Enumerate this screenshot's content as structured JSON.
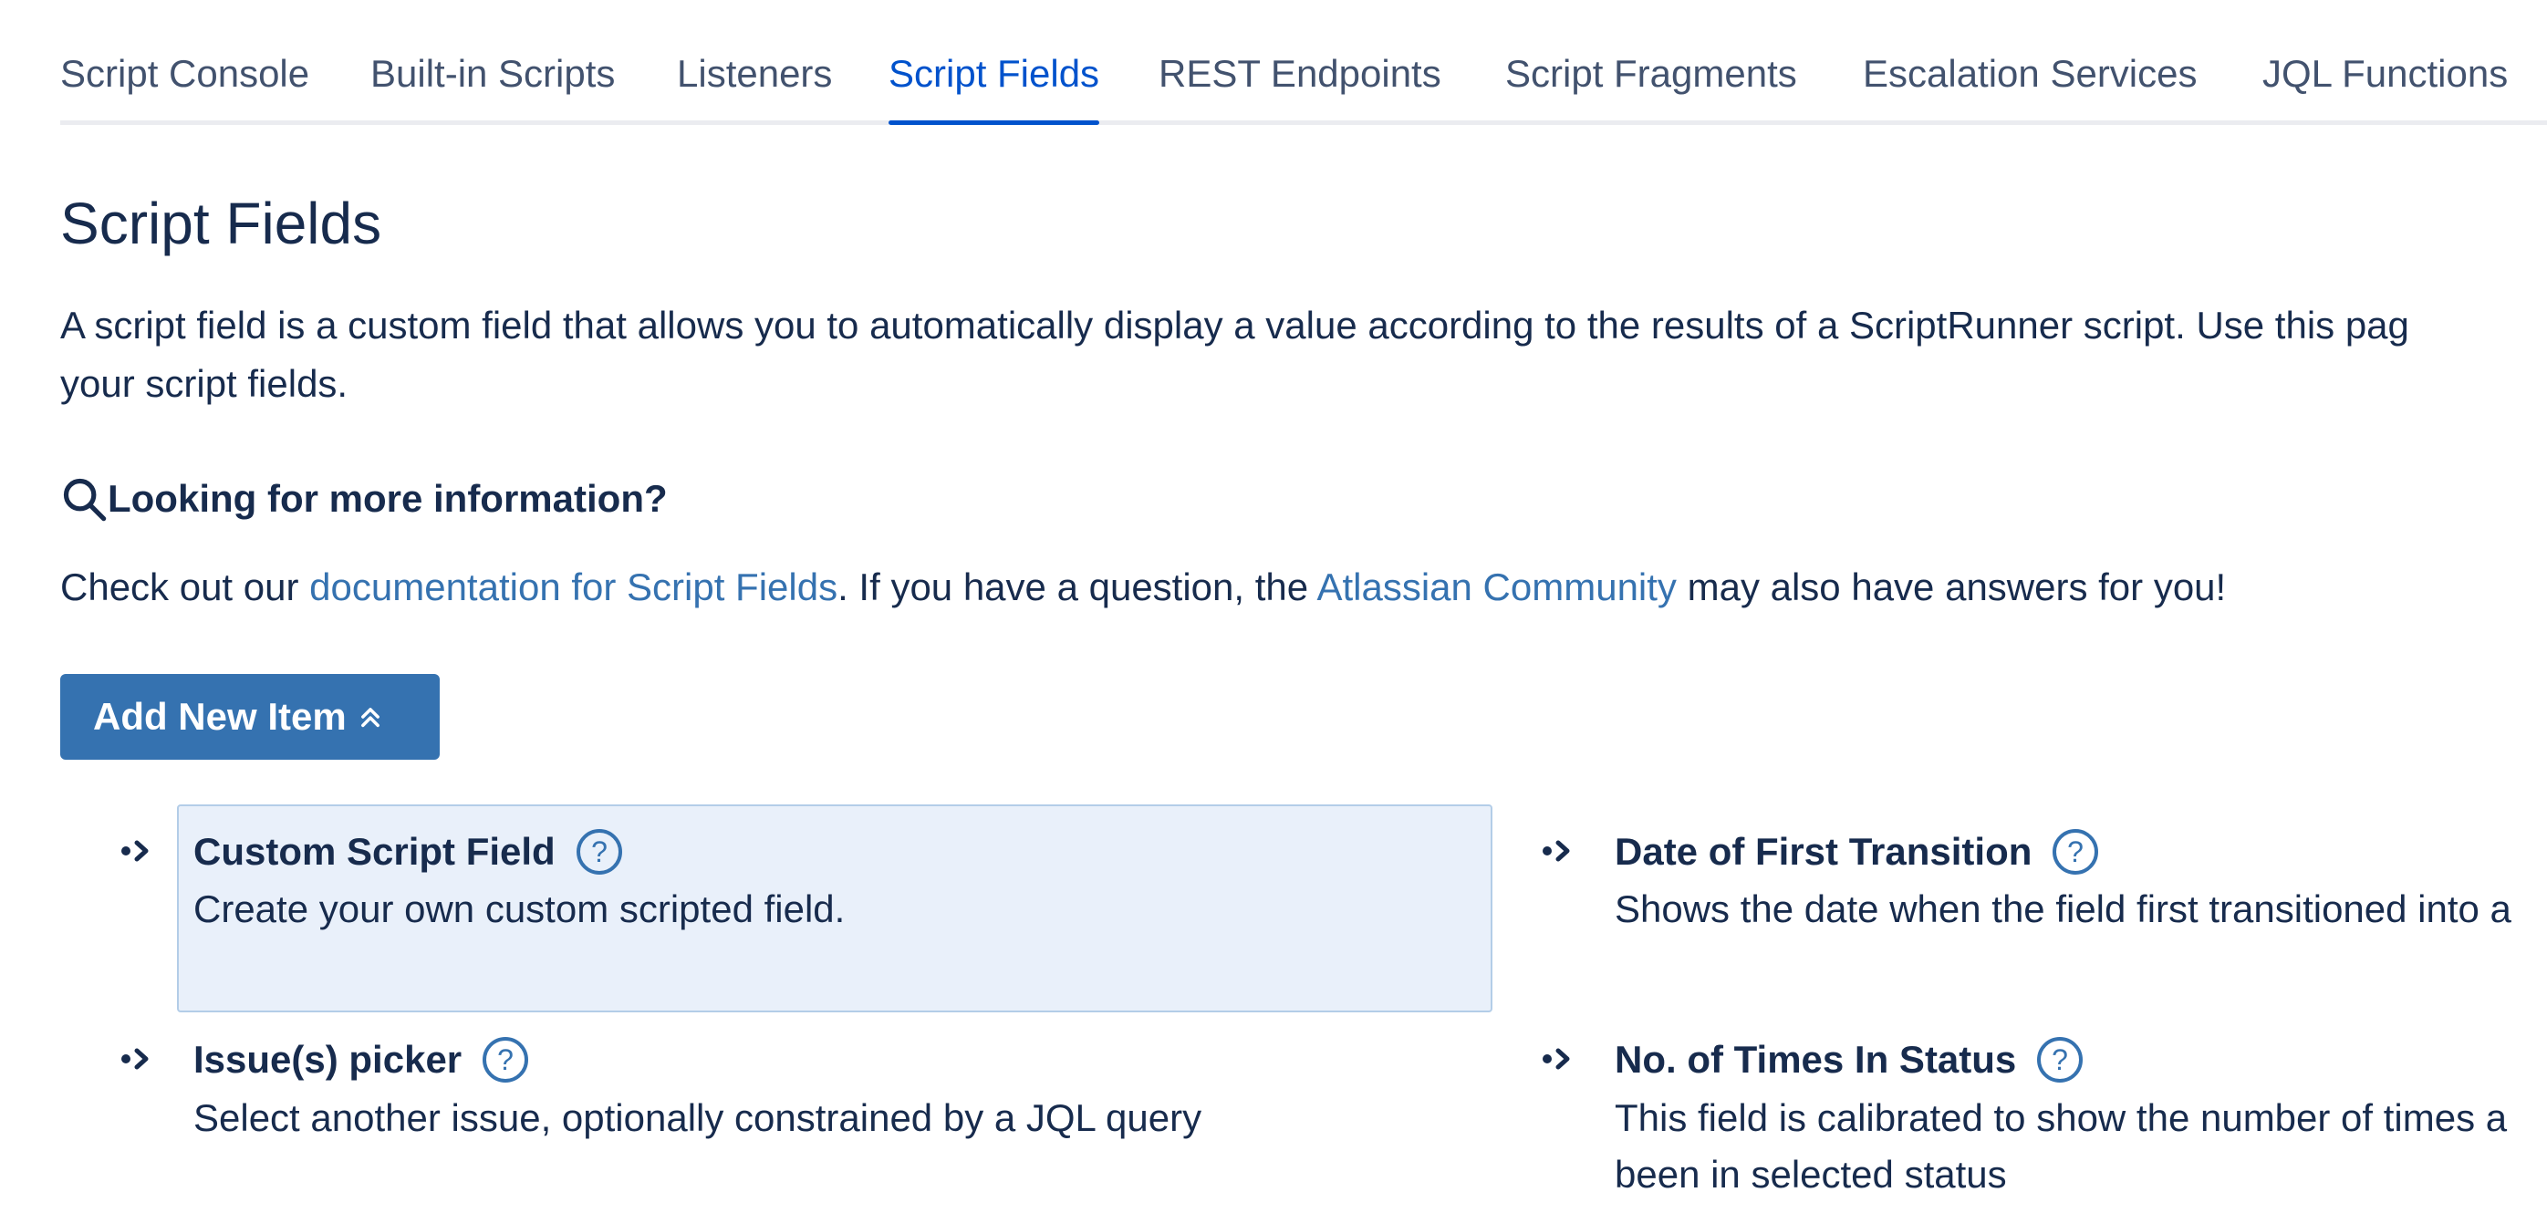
{
  "tabs": [
    {
      "label": "Script Console",
      "active": false
    },
    {
      "label": "Built-in Scripts",
      "active": false
    },
    {
      "label": "Listeners",
      "active": false
    },
    {
      "label": "Script Fields",
      "active": true
    },
    {
      "label": "REST Endpoints",
      "active": false
    },
    {
      "label": "Script Fragments",
      "active": false
    },
    {
      "label": "Escalation Services",
      "active": false
    },
    {
      "label": "JQL Functions",
      "active": false
    }
  ],
  "page": {
    "title": "Script Fields",
    "intro_line1": "A script field is a custom field that allows you to automatically display a value according to the results of a ScriptRunner script. Use this pag",
    "intro_line2": "your script fields."
  },
  "info": {
    "icon": "search-icon",
    "heading": "Looking for more information?",
    "text_before": "Check out our ",
    "doc_link": "documentation for Script Fields",
    "text_middle": ". If you have a question, the ",
    "community_link": "Atlassian Community",
    "text_after": " may also have answers for you!"
  },
  "add_button": {
    "label": "Add New Item",
    "icon": "double-chevron-up-icon"
  },
  "items": [
    {
      "title": "Custom Script Field",
      "desc_lines": [
        "Create your own custom scripted field."
      ],
      "highlighted": true,
      "icon": "help-icon"
    },
    {
      "title": "Date of First Transition",
      "desc_lines": [
        "Shows the date when the field first transitioned into a"
      ],
      "highlighted": false,
      "icon": "help-icon"
    },
    {
      "title": "Issue(s) picker",
      "desc_lines": [
        "Select another issue, optionally constrained by a JQL query"
      ],
      "highlighted": false,
      "icon": "help-icon"
    },
    {
      "title": "No. of Times In Status",
      "desc_lines": [
        "This field is calibrated to show the number of times a",
        "been in selected status"
      ],
      "highlighted": false,
      "icon": "help-icon"
    }
  ],
  "colors": {
    "tab_active": "#0052cc",
    "tab_inactive": "#42526e",
    "link": "#3572b0",
    "button_bg": "#3572b0",
    "highlight_bg": "#e9f0fa",
    "highlight_border": "#b3cde8"
  }
}
